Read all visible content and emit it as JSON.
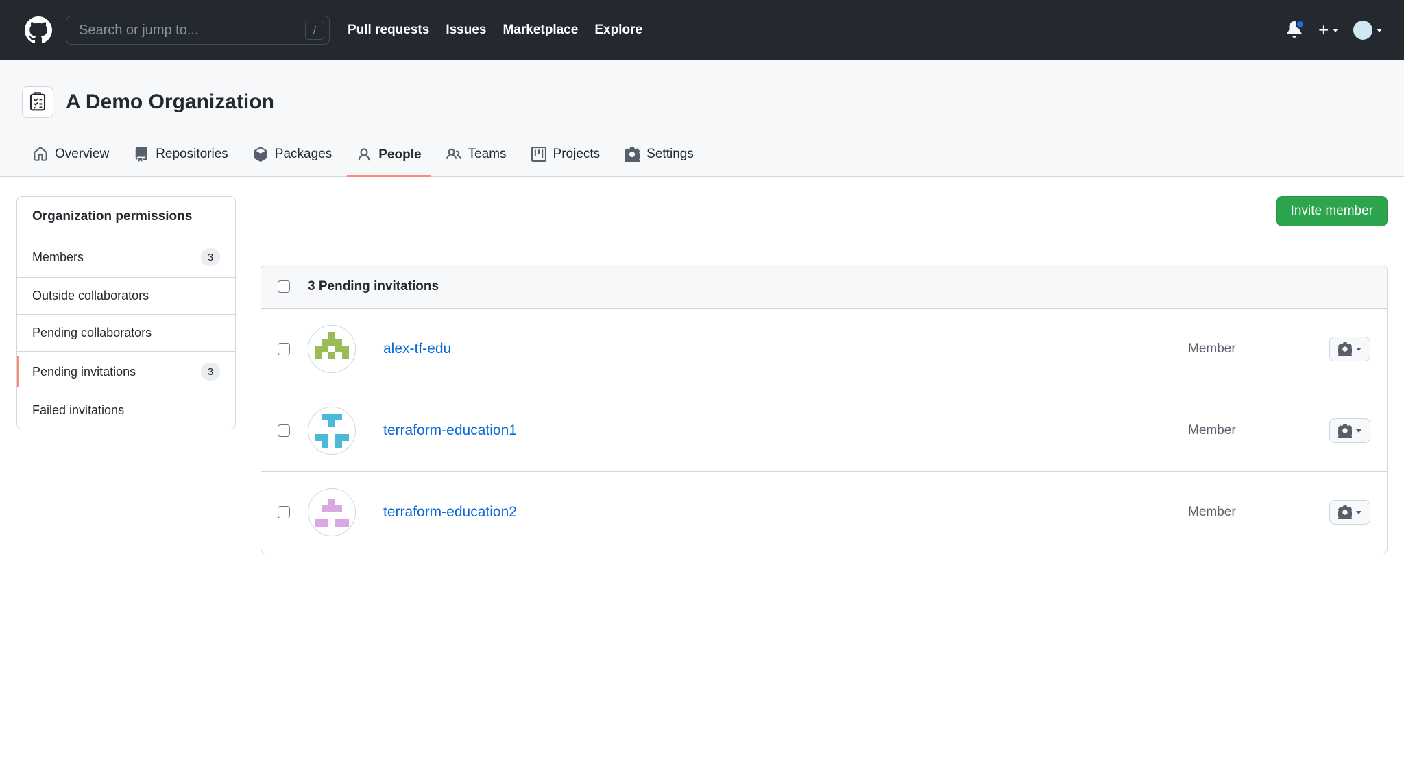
{
  "header": {
    "search_placeholder": "Search or jump to...",
    "slash_hint": "/",
    "nav": [
      "Pull requests",
      "Issues",
      "Marketplace",
      "Explore"
    ]
  },
  "org": {
    "name": "A Demo Organization"
  },
  "tabs": [
    {
      "label": "Overview"
    },
    {
      "label": "Repositories"
    },
    {
      "label": "Packages"
    },
    {
      "label": "People"
    },
    {
      "label": "Teams"
    },
    {
      "label": "Projects"
    },
    {
      "label": "Settings"
    }
  ],
  "sidebar": {
    "title": "Organization permissions",
    "items": [
      {
        "label": "Members",
        "count": "3"
      },
      {
        "label": "Outside collaborators"
      },
      {
        "label": "Pending collaborators"
      },
      {
        "label": "Pending invitations",
        "count": "3"
      },
      {
        "label": "Failed invitations"
      }
    ]
  },
  "actions": {
    "invite_label": "Invite member"
  },
  "list": {
    "header": "3 Pending invitations",
    "rows": [
      {
        "username": "alex-tf-edu",
        "role": "Member",
        "avatar_color": "#9bbb59"
      },
      {
        "username": "terraform-education1",
        "role": "Member",
        "avatar_color": "#4db8d8"
      },
      {
        "username": "terraform-education2",
        "role": "Member",
        "avatar_color": "#d8a8e0"
      }
    ]
  }
}
